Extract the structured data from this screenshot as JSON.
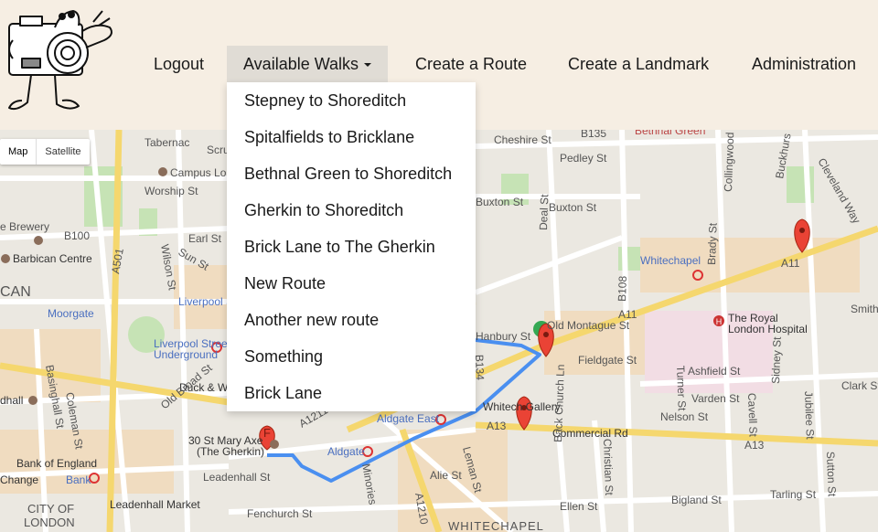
{
  "nav": {
    "logout": "Logout",
    "available_walks": "Available Walks",
    "create_route": "Create a Route",
    "create_landmark": "Create a Landmark",
    "administration": "Administration"
  },
  "walks_menu": [
    "Stepney to Shoreditch",
    "Spitalfields to Bricklane",
    "Bethnal Green to Shoreditch",
    "Gherkin to Shoreditch",
    "Brick Lane to The Gherkin",
    "New Route",
    "Another new route",
    "Something",
    "Brick Lane"
  ],
  "map_type": {
    "map": "Map",
    "satellite": "Satellite"
  },
  "map_labels": {
    "campus": "Campus Lo",
    "worship": "Worship St",
    "brewery": "e Brewery",
    "b100": "B100",
    "earl": "Earl St",
    "barbican": "Barbican Centre",
    "can": "CAN",
    "moorgate": "Moorgate",
    "liverpool_st": "Liverpool St",
    "liverpool_street": "Liverpool Street",
    "underground": "Underground",
    "duck": "Duck & W",
    "thegherkin_addr": "30 St Mary Axe",
    "thegherkin_name": "(The Gherkin)",
    "boe": "Bank of England",
    "bank": "Bank",
    "change": "Change",
    "leadenhall_st": "Leadenhall St",
    "leadenhall_mkt": "Leadenhall Market",
    "city1": "CITY OF",
    "city2": "LONDON",
    "fenchurch": "Fenchurch St",
    "aldgate_east": "Aldgate East",
    "aldgate": "Aldgate",
    "cheshire": "Cheshire St",
    "pedley": "Pedley St",
    "buxton1": "Buxton St",
    "buxton2": "Buxton St",
    "b135": "B135",
    "bethnal_green": "Bethnal Green",
    "collingwood": "Collingwood St",
    "buckhurst": "Buckhurs",
    "cleveland": "Cleveland Way",
    "deal": "Deal St",
    "brady": "Brady St",
    "whitechapel_stn": "Whitechapel",
    "a11_1": "A11",
    "a11_2": "A11",
    "old_montague": "Old Montague St",
    "hanbury": "Hanbury St",
    "b108": "B108",
    "royal_london1": "The Royal",
    "royal_london2": "London Hospital",
    "smith": "Smith",
    "fieldgate": "Fieldgate St",
    "ashfield": "Ashfield St",
    "turner": "Turner St",
    "varden": "Varden St",
    "clark": "Clark St",
    "nelson": "Nelson St",
    "cavell": "Cavell St",
    "sidney": "Sidney St",
    "jubilee": "Jubilee St",
    "whitechapel_gallery": "Whitech   Gallery",
    "a13_1": "A13",
    "a13_2": "A13",
    "commercial": "Commercial Rd",
    "b134": "B134",
    "leman": "Leman St",
    "alie": "Alie St",
    "minories": "Minories",
    "a1210": "A1210",
    "a1211": "A1211",
    "back_church": "Back Church Ln",
    "christian": "Christian St",
    "ellen": "Ellen St",
    "bigland": "Bigland St",
    "tarling": "Tarling St",
    "sutton": "Sutton St",
    "whitechapel_area": "WHITECHAPEL",
    "old_broad": "Old Broad St",
    "a501": "A501",
    "basinghall": "Basinghall St",
    "coleman": "Coleman St",
    "wilson": "Wilson St",
    "sun": "Sun St",
    "tabernacle": "Tabernac",
    "scru": "Scru",
    "idhall": "dhall",
    "marker_letter": "F"
  }
}
